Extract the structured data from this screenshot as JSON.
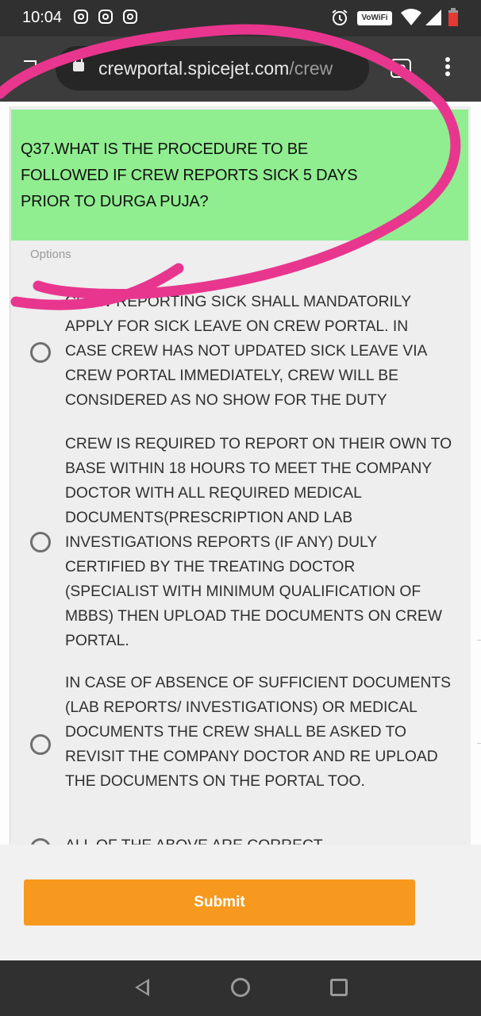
{
  "status_bar": {
    "time": "10:04",
    "vowifi_label": "VoWiFi",
    "icons": [
      "instagram-icon",
      "instagram-icon",
      "instagram-icon",
      "alarm-icon",
      "wifi-icon",
      "signal-icon",
      "battery-icon"
    ]
  },
  "browser": {
    "url_host": "crewportal.spicejet.com",
    "url_path": "/crew",
    "tab_switcher_label": ":D"
  },
  "question": {
    "text": "Q37.WHAT IS THE PROCEDURE TO BE FOLLOWED IF CREW REPORTS SICK 5 DAYS PRIOR TO DURGA PUJA?",
    "highlight_color": "#90EE90"
  },
  "options_label": "Options",
  "options": [
    {
      "text": "CREW REPORTING SICK SHALL MANDATORILY APPLY FOR SICK LEAVE ON CREW PORTAL. IN CASE CREW HAS NOT UPDATED SICK LEAVE VIA CREW PORTAL IMMEDIATELY, CREW WILL BE CONSIDERED AS NO SHOW FOR THE DUTY",
      "selected": false
    },
    {
      "text": "CREW IS REQUIRED TO REPORT ON THEIR OWN TO BASE WITHIN 18 HOURS TO MEET THE COMPANY DOCTOR WITH ALL REQUIRED MEDICAL DOCUMENTS(PRESCRIPTION AND LAB INVESTIGATIONS REPORTS (IF ANY) DULY CERTIFIED BY THE TREATING DOCTOR (SPECIALIST WITH MINIMUM QUALIFICATION OF MBBS) THEN UPLOAD THE DOCUMENTS ON CREW PORTAL.",
      "selected": false
    },
    {
      "text": "IN CASE OF ABSENCE OF SUFFICIENT DOCUMENTS (LAB REPORTS/ INVESTIGATIONS) OR MEDICAL DOCUMENTS THE CREW SHALL BE ASKED TO REVISIT THE COMPANY DOCTOR AND RE UPLOAD THE DOCUMENTS ON THE PORTAL TOO.",
      "selected": false
    },
    {
      "text": "ALL OF THE ABOVE ARE CORRECT",
      "selected": false
    }
  ],
  "submit_label": "Submit",
  "colors": {
    "submit": "#F7991E",
    "annotation": "#E8368F"
  }
}
